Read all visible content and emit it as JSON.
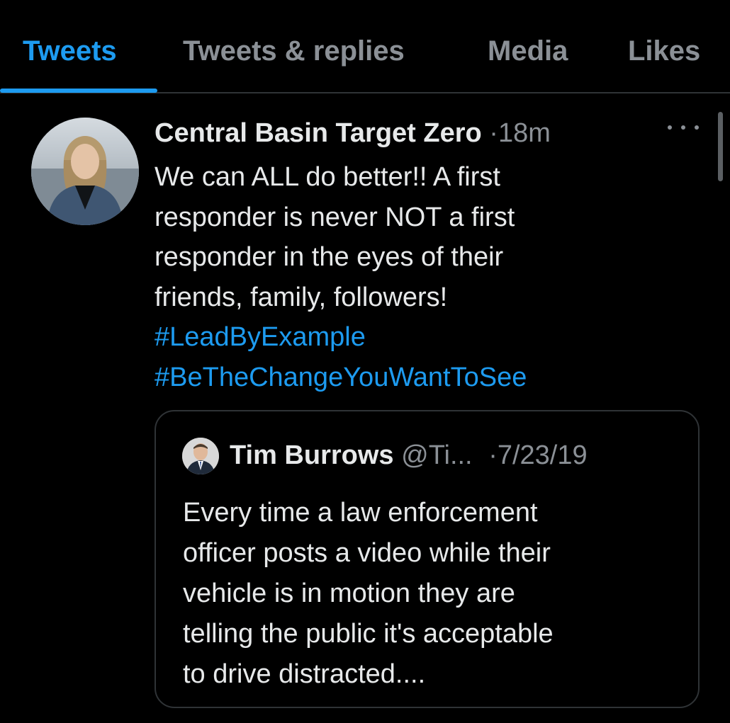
{
  "tabs": [
    {
      "label": "Tweets",
      "active": true
    },
    {
      "label": "Tweets & replies",
      "active": false
    },
    {
      "label": "Media",
      "active": false
    },
    {
      "label": "Likes",
      "active": false
    }
  ],
  "tweet": {
    "author": "Central Basin Target Zero",
    "separator": "·",
    "time": "18m",
    "text_lines": [
      "We can ALL do better!!  A first",
      "responder is never NOT a first",
      "responder in the eyes of their",
      "friends, family, followers!"
    ],
    "hashtags": [
      "#LeadByExample",
      "#BeTheChangeYouWantToSee"
    ],
    "quoted": {
      "author": "Tim Burrows",
      "handle": "@Ti...",
      "separator": "·",
      "date": "7/23/19",
      "text_lines": [
        "Every time a law enforcement",
        "officer posts a video while their",
        "vehicle is in motion they are",
        "telling the public it's acceptable",
        "to drive distracted...."
      ]
    }
  },
  "colors": {
    "background": "#000000",
    "accent": "#1d9bf0",
    "text": "#e7e9ea",
    "muted": "#8b9096",
    "border": "#2f3336"
  }
}
